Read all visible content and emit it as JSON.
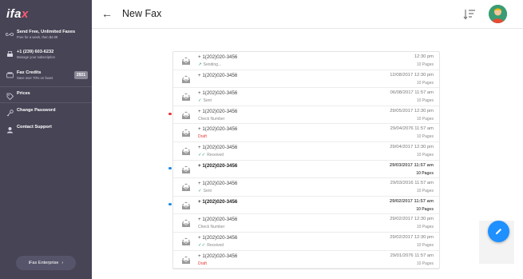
{
  "logo": "ifax",
  "sidebar": {
    "items": [
      {
        "title": "Send Free, Unlimited Faxes",
        "sub": "Free for a week, then $4.99",
        "icon": "infinity-icon"
      },
      {
        "title": "+1 (239) 603-6232",
        "sub": "Manage your subscription",
        "icon": "fax-machine-icon"
      },
      {
        "title": "Fax Credits",
        "sub": "Save over 70% on faxes",
        "badge": "2921",
        "icon": "credits-icon"
      },
      {
        "title": "Prices",
        "icon": "tag-icon"
      },
      {
        "title": "Change Password",
        "icon": "key-icon"
      },
      {
        "title": "Contact Support",
        "icon": "support-icon"
      }
    ],
    "enterprise": "iFax Enterprise",
    "enterprise_chevron": "›"
  },
  "header": {
    "back": "←",
    "title": "New Fax"
  },
  "faxes": [
    {
      "number": "+ 1(202)020-3456",
      "status": "Sending...",
      "status_type": "sending",
      "date": "12:30 pm",
      "pages": "10 Pages",
      "unread": false,
      "dot": ""
    },
    {
      "number": "+ 1(202)020-3456",
      "status": "",
      "status_type": "none",
      "date": "12/08/2017 12:30 pm",
      "pages": "10 Pages",
      "unread": false,
      "dot": ""
    },
    {
      "number": "+ 1(202)020-3456",
      "status": "Sent",
      "status_type": "sent",
      "date": "06/08/2017 11:57 am",
      "pages": "10 Pages",
      "unread": false,
      "dot": ""
    },
    {
      "number": "+ 1(202)020-3456",
      "status": "Check Number",
      "status_type": "plain",
      "date": "29/05/2017 12:30 pm",
      "pages": "10 Pages",
      "unread": false,
      "dot": "#e53935"
    },
    {
      "number": "+ 1(202)020-3456",
      "status": "Draft",
      "status_type": "draft",
      "date": "29/04/2076 11:57 am",
      "pages": "10 Pages",
      "unread": false,
      "dot": ""
    },
    {
      "number": "+ 1(202)020-3456",
      "status": "Received",
      "status_type": "received",
      "date": "29/04/2017 12:30 pm",
      "pages": "10 Pages",
      "unread": false,
      "dot": ""
    },
    {
      "number": "+ 1(202)020-3456",
      "status": "",
      "status_type": "none",
      "date": "29/03/2017 11:57 am",
      "pages": "10 Pages",
      "unread": true,
      "dot": "#1e88e5"
    },
    {
      "number": "+ 1(202)020-3456",
      "status": "Sent",
      "status_type": "sent",
      "date": "29/03/2016 11:57 am",
      "pages": "10 Pages",
      "unread": false,
      "dot": ""
    },
    {
      "number": "+ 1(202)020-3456",
      "status": "",
      "status_type": "none",
      "date": "29/02/2017 11:57 am",
      "pages": "10 Pages",
      "unread": true,
      "dot": "#1e88e5"
    },
    {
      "number": "+ 1(202)020-3456",
      "status": "Check Number",
      "status_type": "plain",
      "date": "29/02/2017 12:30 pm",
      "pages": "10 Pages",
      "unread": false,
      "dot": ""
    },
    {
      "number": "+ 1(202)020-3456",
      "status": "Received",
      "status_type": "received",
      "date": "29/02/2017 12:30 pm",
      "pages": "10 Pages",
      "unread": false,
      "dot": ""
    },
    {
      "number": "+ 1(202)020-3456",
      "status": "Draft",
      "status_type": "draft",
      "date": "29/01/2076 11:57 am",
      "pages": "10 Pages",
      "unread": false,
      "dot": ""
    }
  ],
  "colors": {
    "sidebar": "#464455",
    "accent": "#1e90ff",
    "draft": "#e53935",
    "sent": "#2f9d6b"
  }
}
